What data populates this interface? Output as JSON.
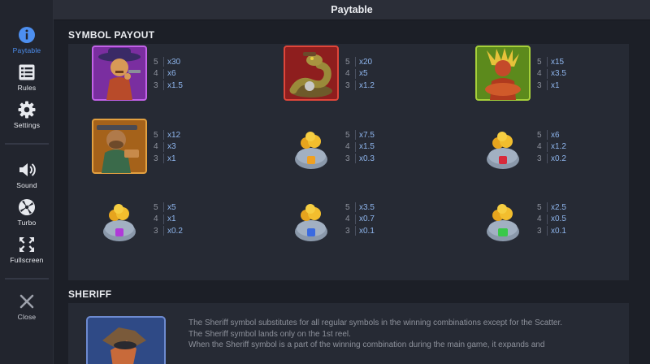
{
  "header": {
    "title": "Paytable"
  },
  "sidebar": {
    "items": [
      {
        "label": "Paytable",
        "icon": "info-icon",
        "active": true
      },
      {
        "label": "Rules",
        "icon": "list-icon"
      },
      {
        "label": "Settings",
        "icon": "gear-icon"
      },
      {
        "label": "Sound",
        "icon": "speaker-icon"
      },
      {
        "label": "Turbo",
        "icon": "turbo-icon"
      },
      {
        "label": "Fullscreen",
        "icon": "fullscreen-icon"
      },
      {
        "label": "Close",
        "icon": "close-icon"
      }
    ]
  },
  "symbol_payout": {
    "title": "SYMBOL PAYOUT",
    "symbols": [
      {
        "icon": "gunslinger-symbol-icon",
        "pays": [
          {
            "n": "5",
            "v": "x30"
          },
          {
            "n": "4",
            "v": "x6"
          },
          {
            "n": "3",
            "v": "x1.5"
          }
        ]
      },
      {
        "icon": "snake-symbol-icon",
        "pays": [
          {
            "n": "5",
            "v": "x20"
          },
          {
            "n": "4",
            "v": "x5"
          },
          {
            "n": "3",
            "v": "x1.2"
          }
        ]
      },
      {
        "icon": "chief-symbol-icon",
        "pays": [
          {
            "n": "5",
            "v": "x15"
          },
          {
            "n": "4",
            "v": "x3.5"
          },
          {
            "n": "3",
            "v": "x1"
          }
        ]
      },
      {
        "icon": "bandit-symbol-icon",
        "pays": [
          {
            "n": "5",
            "v": "x12"
          },
          {
            "n": "4",
            "v": "x3"
          },
          {
            "n": "3",
            "v": "x1"
          }
        ]
      },
      {
        "icon": "money-bag-a-icon",
        "pays": [
          {
            "n": "5",
            "v": "x7.5"
          },
          {
            "n": "4",
            "v": "x1.5"
          },
          {
            "n": "3",
            "v": "x0.3"
          }
        ]
      },
      {
        "icon": "money-bag-k-icon",
        "pays": [
          {
            "n": "5",
            "v": "x6"
          },
          {
            "n": "4",
            "v": "x1.2"
          },
          {
            "n": "3",
            "v": "x0.2"
          }
        ]
      },
      {
        "icon": "money-bag-q-icon",
        "pays": [
          {
            "n": "5",
            "v": "x5"
          },
          {
            "n": "4",
            "v": "x1"
          },
          {
            "n": "3",
            "v": "x0.2"
          }
        ]
      },
      {
        "icon": "money-bag-j-icon",
        "pays": [
          {
            "n": "5",
            "v": "x3.5"
          },
          {
            "n": "4",
            "v": "x0.7"
          },
          {
            "n": "3",
            "v": "x0.1"
          }
        ]
      },
      {
        "icon": "money-bag-10-icon",
        "pays": [
          {
            "n": "5",
            "v": "x2.5"
          },
          {
            "n": "4",
            "v": "x0.5"
          },
          {
            "n": "3",
            "v": "x0.1"
          }
        ]
      }
    ]
  },
  "sheriff": {
    "title": "SHERIFF",
    "lines": [
      "The Sheriff symbol substitutes for all regular symbols in the winning combinations except for the Scatter.",
      "The Sheriff symbol lands only on the 1st reel.",
      "When the Sheriff symbol is a part of the winning combination during the main game, it expands and"
    ]
  },
  "colors": {
    "accent": "#4d8ff0",
    "value": "#8fb6ee",
    "background": "#1c1f27",
    "panel": "#262a34"
  }
}
